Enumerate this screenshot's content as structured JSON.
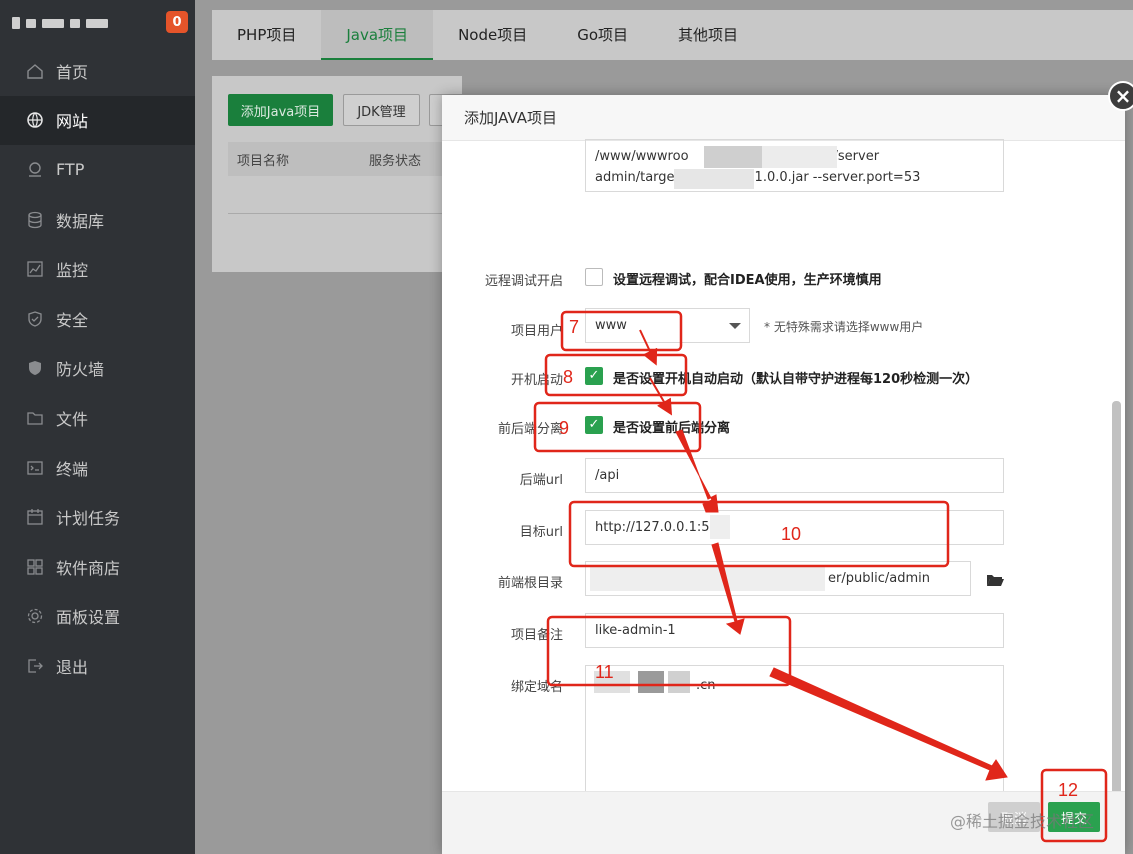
{
  "sidebar": {
    "badge": "0",
    "items": [
      {
        "label": "首页",
        "icon": "home-icon"
      },
      {
        "label": "网站",
        "icon": "globe-icon",
        "active": true
      },
      {
        "label": "FTP",
        "icon": "ftp-icon"
      },
      {
        "label": "数据库",
        "icon": "database-icon"
      },
      {
        "label": "监控",
        "icon": "monitor-icon"
      },
      {
        "label": "安全",
        "icon": "shield-icon"
      },
      {
        "label": "防火墙",
        "icon": "firewall-icon"
      },
      {
        "label": "文件",
        "icon": "folder-icon"
      },
      {
        "label": "终端",
        "icon": "terminal-icon"
      },
      {
        "label": "计划任务",
        "icon": "calendar-icon"
      },
      {
        "label": "软件商店",
        "icon": "apps-icon"
      },
      {
        "label": "面板设置",
        "icon": "gear-icon"
      },
      {
        "label": "退出",
        "icon": "logout-icon"
      }
    ]
  },
  "tabs": [
    "PHP项目",
    "Java项目",
    "Node项目",
    "Go项目",
    "其他项目"
  ],
  "toolbar": {
    "add_label": "添加Java项目",
    "jdk_label": "JDK管理"
  },
  "table": {
    "col_name": "项目名称",
    "col_status": "服务状态"
  },
  "modal": {
    "title": "添加JAVA项目",
    "cmd_line1": "/www/wwwroo",
    "cmd_line1_end": "/server",
    "cmd_line2": "admin/targe",
    "cmd_line2_end": "1.0.0.jar --server.port=53",
    "remote_debug_label": "远程调试开启",
    "remote_debug_text": "设置远程调试，配合IDEA使用，生产环境慎用",
    "user_label": "项目用户",
    "user_value": "www",
    "user_hint": "* 无特殊需求请选择www用户",
    "autostart_label": "开机启动",
    "autostart_text": "是否设置开机自动启动（默认自带守护进程每120秒检测一次）",
    "separate_label": "前后端分离",
    "separate_text": "是否设置前后端分离",
    "backend_url_label": "后端url",
    "backend_url_value": "/api",
    "target_url_label": "目标url",
    "target_url_value": "http://127.0.0.1:53",
    "frontend_root_label": "前端根目录",
    "frontend_root_value": "er/public/admin",
    "remark_label": "项目备注",
    "remark_value": "like-admin-1",
    "domain_label": "绑定域名",
    "domain_value": ".cn",
    "cancel_label": "取消",
    "submit_label": "提交"
  },
  "annotations": [
    "7",
    "8",
    "9",
    "10",
    "11",
    "12"
  ],
  "watermark": "@稀土掘金技术社区",
  "colors": {
    "accent": "#2aa14f",
    "annotation": "#e0261a",
    "sidebar": "#2f3236"
  }
}
